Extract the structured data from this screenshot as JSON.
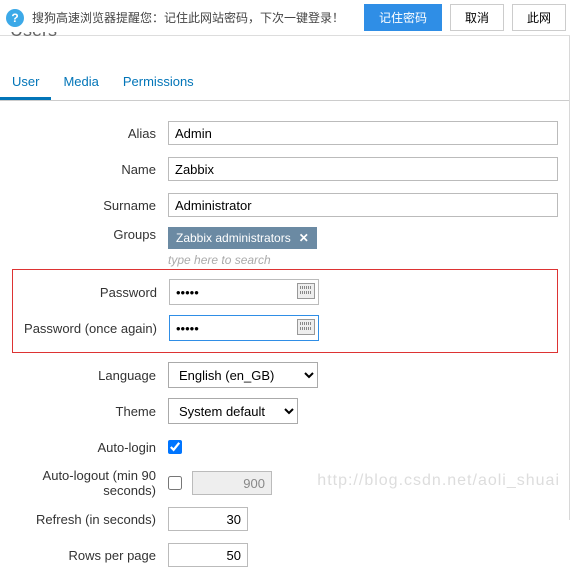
{
  "browser_bar": {
    "message": "搜狗高速浏览器提醒您：记住此网站密码，下次一键登录！",
    "remember": "记住密码",
    "cancel": "取消",
    "this": "此网"
  },
  "page_title_fragment": "Users",
  "tabs": {
    "user": "User",
    "media": "Media",
    "permissions": "Permissions"
  },
  "form": {
    "alias_label": "Alias",
    "alias": "Admin",
    "name_label": "Name",
    "name": "Zabbix",
    "surname_label": "Surname",
    "surname": "Administrator",
    "groups_label": "Groups",
    "group_tag": "Zabbix administrators",
    "type_to_search": "type here to search",
    "password_label": "Password",
    "password": "•••••",
    "password2_label": "Password (once again)",
    "password2": "•••••",
    "language_label": "Language",
    "language": "English (en_GB)",
    "theme_label": "Theme",
    "theme": "System default",
    "autologin_label": "Auto-login",
    "autologout_label": "Auto-logout (min 90 seconds)",
    "autologout": "900",
    "refresh_label": "Refresh (in seconds)",
    "refresh": "30",
    "rows_label": "Rows per page",
    "rows": "50"
  },
  "watermark": "http://blog.csdn.net/aoli_shuai"
}
